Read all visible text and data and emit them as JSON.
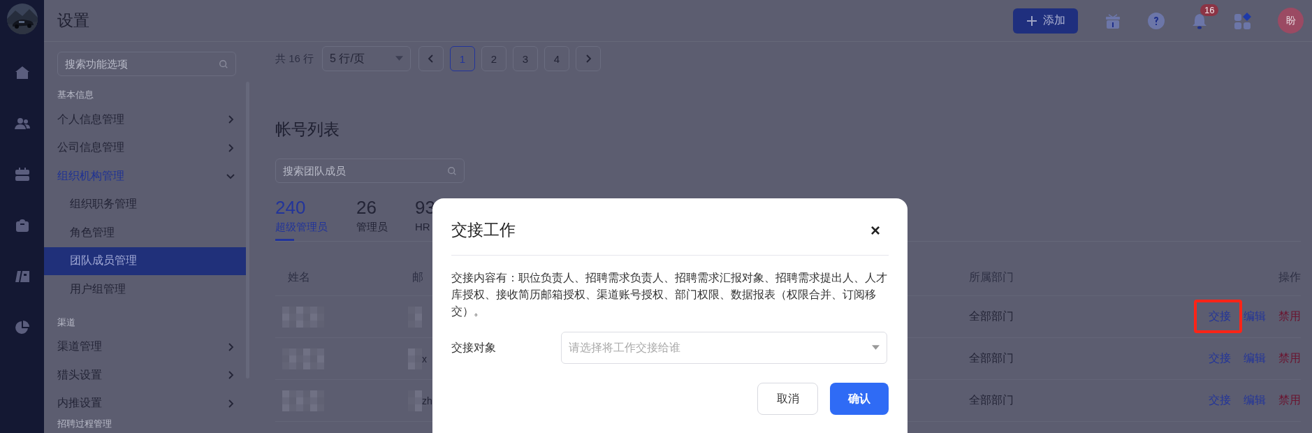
{
  "header": {
    "title": "设置",
    "add_button": "添加",
    "notification_badge": "16",
    "avatar": "盼"
  },
  "sidebar": {
    "search_placeholder": "搜索功能选项",
    "sections": [
      {
        "label": "基本信息",
        "items": [
          {
            "label": "个人信息管理",
            "expanded": false,
            "selected": false
          },
          {
            "label": "公司信息管理",
            "expanded": false,
            "selected": false
          },
          {
            "label": "组织机构管理",
            "expanded": true,
            "selected": false,
            "children": [
              {
                "label": "组织职务管理",
                "selected": false
              },
              {
                "label": "角色管理",
                "selected": false
              },
              {
                "label": "团队成员管理",
                "selected": true
              },
              {
                "label": "用户组管理",
                "selected": false
              }
            ]
          }
        ]
      },
      {
        "label": "渠道",
        "items": [
          {
            "label": "渠道管理",
            "expanded": false,
            "selected": false
          },
          {
            "label": "猎头设置",
            "expanded": false,
            "selected": false
          },
          {
            "label": "内推设置",
            "expanded": false,
            "selected": false
          }
        ]
      },
      {
        "label": "招聘过程管理"
      }
    ]
  },
  "pagination": {
    "total": "共 16 行",
    "page_size": "5 行/页",
    "pages": [
      {
        "label": "1",
        "selected": true
      },
      {
        "label": "2",
        "selected": false
      },
      {
        "label": "3",
        "selected": false
      },
      {
        "label": "4",
        "selected": false
      }
    ]
  },
  "account_list": {
    "title": "帐号列表",
    "search_placeholder": "搜索团队成员",
    "stats": [
      {
        "value": "240",
        "label": "超级管理员",
        "selected": true
      },
      {
        "value": "26",
        "label": "管理员",
        "selected": false
      },
      {
        "value": "93",
        "label": "HR",
        "selected": false
      }
    ]
  },
  "table": {
    "columns": [
      "姓名",
      "邮",
      "所属部门",
      "操作"
    ],
    "rows": [
      {
        "department": "全部部门",
        "actions": [
          {
            "label": "交接",
            "kind": "handover",
            "highlighted": true
          },
          {
            "label": "编辑",
            "kind": "edit",
            "highlighted": false
          },
          {
            "label": "禁用",
            "kind": "disable",
            "highlighted": false
          }
        ]
      },
      {
        "email": "x",
        "department": "全部部门",
        "actions": [
          {
            "label": "交接",
            "kind": "handover",
            "highlighted": false
          },
          {
            "label": "编辑",
            "kind": "edit",
            "highlighted": false
          },
          {
            "label": "禁用",
            "kind": "disable",
            "highlighted": false
          }
        ]
      },
      {
        "email": "zh",
        "department": "全部部门",
        "actions": [
          {
            "label": "交接",
            "kind": "handover",
            "highlighted": false
          },
          {
            "label": "编辑",
            "kind": "edit",
            "highlighted": false
          },
          {
            "label": "禁用",
            "kind": "disable",
            "highlighted": false
          }
        ]
      }
    ]
  },
  "dialog": {
    "title": "交接工作",
    "close": "×",
    "description": "交接内容有：职位负责人、招聘需求负责人、招聘需求汇报对象、招聘需求提出人、人才库授权、接收简历邮箱授权、渠道账号授权、部门权限、数据报表（权限合并、订阅移交）。",
    "field_label": "交接对象",
    "placeholder": "请选择将工作交接给谁",
    "buttons": [
      {
        "label": "取消",
        "kind": "secondary"
      },
      {
        "label": "确认",
        "kind": "primary"
      }
    ]
  }
}
